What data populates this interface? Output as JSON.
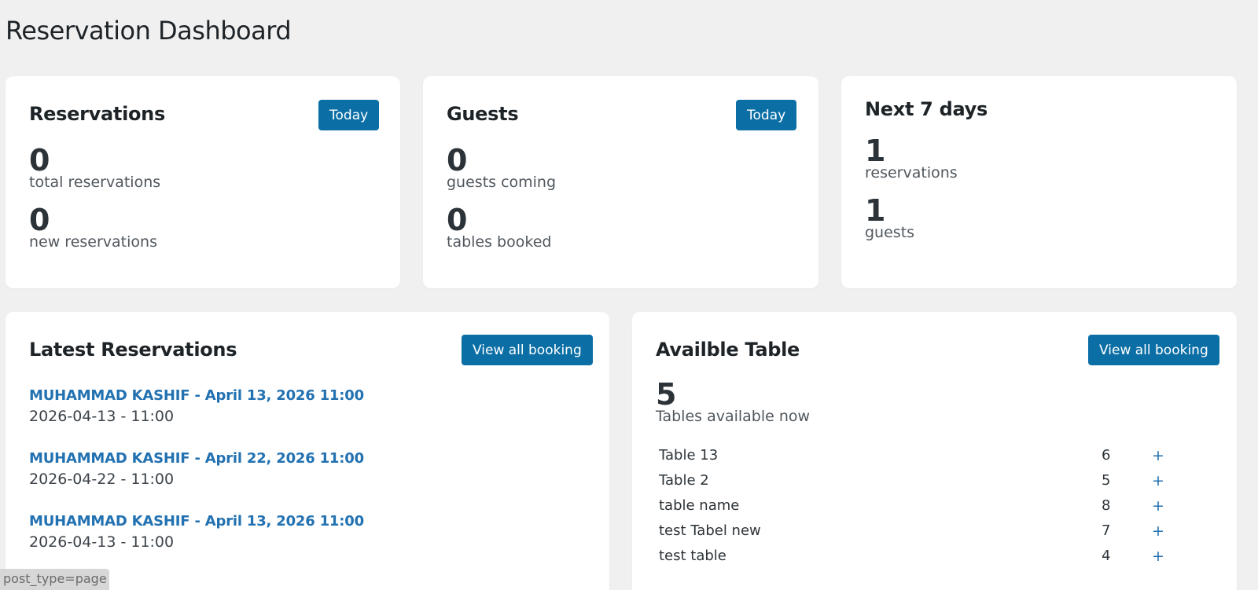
{
  "page": {
    "title": "Reservation Dashboard"
  },
  "reservations_card": {
    "title": "Reservations",
    "button": "Today",
    "stats": [
      {
        "value": "0",
        "label": "total reservations"
      },
      {
        "value": "0",
        "label": "new reservations"
      }
    ]
  },
  "guests_card": {
    "title": "Guests",
    "button": "Today",
    "stats": [
      {
        "value": "0",
        "label": "guests coming"
      },
      {
        "value": "0",
        "label": "tables booked"
      }
    ]
  },
  "next7_card": {
    "title": "Next 7 days",
    "stats": [
      {
        "value": "1",
        "label": "reservations"
      },
      {
        "value": "1",
        "label": "guests"
      }
    ]
  },
  "latest_card": {
    "title": "Latest Reservations",
    "button": "View all booking",
    "items": [
      {
        "link": "MUHAMMAD KASHIF - April 13, 2026 11:00",
        "date": "2026-04-13 - 11:00"
      },
      {
        "link": "MUHAMMAD KASHIF - April 22, 2026 11:00",
        "date": "2026-04-22 - 11:00"
      },
      {
        "link": "MUHAMMAD KASHIF - April 13, 2026 11:00",
        "date": "2026-04-13 - 11:00"
      }
    ]
  },
  "tables_card": {
    "title": "Availble Table",
    "button": "View all booking",
    "count": "5",
    "count_label": "Tables available now",
    "add_symbol": "+",
    "rows": [
      {
        "name": "Table 13",
        "capacity": "6"
      },
      {
        "name": "Table 2",
        "capacity": "5"
      },
      {
        "name": "table name",
        "capacity": "8"
      },
      {
        "name": "test Tabel new",
        "capacity": "7"
      },
      {
        "name": "test table",
        "capacity": "4"
      }
    ]
  },
  "status_bar": {
    "text": "post_type=page"
  },
  "colors": {
    "accent": "#0b6fa6",
    "link": "#2271b1",
    "background": "#f0f0f1"
  }
}
